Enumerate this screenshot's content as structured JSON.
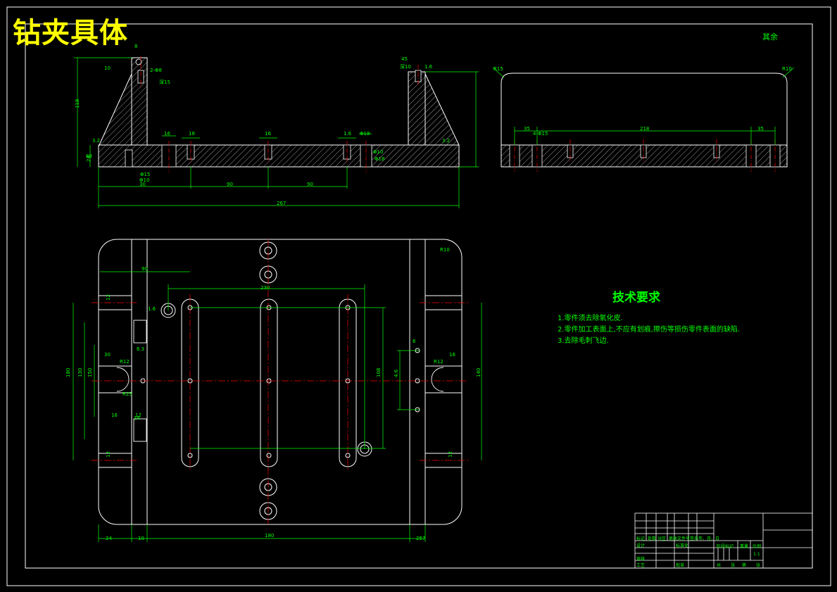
{
  "title": "钻夹具体",
  "surface_note": "其余",
  "tech_requirements": {
    "heading": "技术要求",
    "items": [
      "1.零件须去除氧化皮.",
      "2.零件加工表面上,不应有划痕,擦伤等损伤零件表面的缺陷.",
      "3.去除毛刺飞边."
    ]
  },
  "title_block": {
    "cells": [
      "标记",
      "处数",
      "分区",
      "更改文件号",
      "签名",
      "年、月、日",
      "设计",
      "标准化",
      "审核",
      "工艺",
      "批准",
      "阶段标记",
      "重量",
      "比例",
      "1:1",
      "共",
      "张",
      "第",
      "张"
    ]
  },
  "dims": {
    "front_top": [
      "8",
      "10",
      "2-Φ8",
      "深15",
      "45",
      "深10",
      "1.6",
      "118",
      "88",
      "3.2",
      "24",
      "Φ15",
      "18",
      "16",
      "Φ10",
      "16",
      "Φ18",
      "1.6",
      "Φ10",
      "Φ18",
      "3.2",
      "30",
      "90",
      "90",
      "267"
    ],
    "side": [
      "R15",
      "R10",
      "35",
      "218",
      "35",
      "4-Φ15"
    ],
    "plan": [
      "R10",
      "90",
      "230",
      "12",
      "6.3",
      "1.6",
      "16",
      "R12",
      "R25",
      "12",
      "180",
      "130",
      "150",
      "108",
      "4.6",
      "16",
      "12",
      "30",
      "140",
      "6",
      "16",
      "R12",
      "12",
      "180",
      "24",
      "10",
      "257",
      "10"
    ]
  },
  "colors": {
    "background": "#000000",
    "outline": "#ffffff",
    "dimension": "#00ff00",
    "centerline": "#ff0000",
    "title": "#ffff00"
  }
}
